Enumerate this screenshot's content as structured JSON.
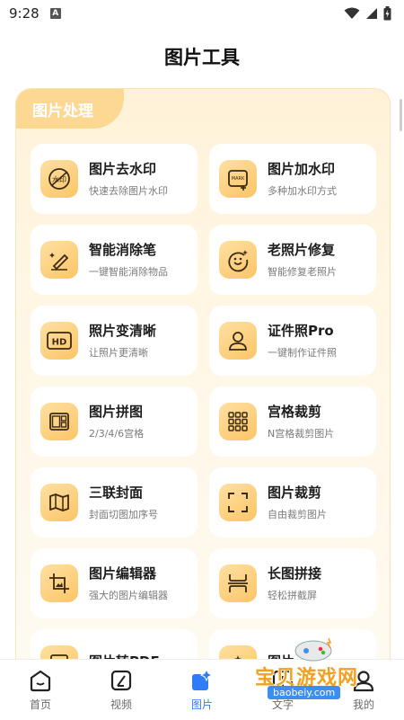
{
  "status_bar": {
    "time": "9:28",
    "notification_icon": "A"
  },
  "header": {
    "title": "图片工具"
  },
  "section": {
    "title": "图片处理"
  },
  "tools": [
    {
      "name": "图片去水印",
      "desc": "快速去除图片水印",
      "icon": "remove-watermark-icon",
      "badge": "水印"
    },
    {
      "name": "图片加水印",
      "desc": "多种加水印方式",
      "icon": "add-watermark-icon",
      "badge": "MARK"
    },
    {
      "name": "智能消除笔",
      "desc": "一键智能消除物品",
      "icon": "eraser-pen-icon"
    },
    {
      "name": "老照片修复",
      "desc": "智能修复老照片",
      "icon": "photo-restore-icon"
    },
    {
      "name": "照片变清晰",
      "desc": "让照片更清晰",
      "icon": "hd-icon",
      "badge": "HD"
    },
    {
      "name": "证件照Pro",
      "desc": "一键制作证件照",
      "icon": "id-photo-icon"
    },
    {
      "name": "图片拼图",
      "desc": "2/3/4/6宫格",
      "icon": "collage-icon"
    },
    {
      "name": "宫格裁剪",
      "desc": "N宫格裁剪图片",
      "icon": "grid-crop-icon"
    },
    {
      "name": "三联封面",
      "desc": "封面切图加序号",
      "icon": "triptych-cover-icon"
    },
    {
      "name": "图片裁剪",
      "desc": "自由裁剪图片",
      "icon": "crop-icon"
    },
    {
      "name": "图片编辑器",
      "desc": "强大的图片编辑器",
      "icon": "image-editor-icon"
    },
    {
      "name": "长图拼接",
      "desc": "轻松拼截屏",
      "icon": "long-stitch-icon"
    },
    {
      "name": "图片转PDF",
      "desc": "",
      "icon": "image-to-pdf-icon"
    },
    {
      "name": "图片",
      "desc": "",
      "icon": "image-tool-icon"
    }
  ],
  "tabbar": [
    {
      "label": "首页",
      "icon": "home-icon",
      "active": false
    },
    {
      "label": "视频",
      "icon": "video-icon",
      "active": false
    },
    {
      "label": "图片",
      "icon": "image-icon",
      "active": true
    },
    {
      "label": "文字",
      "icon": "text-icon",
      "active": false
    },
    {
      "label": "我的",
      "icon": "profile-icon",
      "active": false
    }
  ],
  "watermark": {
    "text": "宝贝游戏网",
    "url": "baobeiy.com"
  },
  "colors": {
    "accent": "#2f7cf6",
    "icon_bg": "#fbc567",
    "panel_bg": "#fff2d8"
  }
}
